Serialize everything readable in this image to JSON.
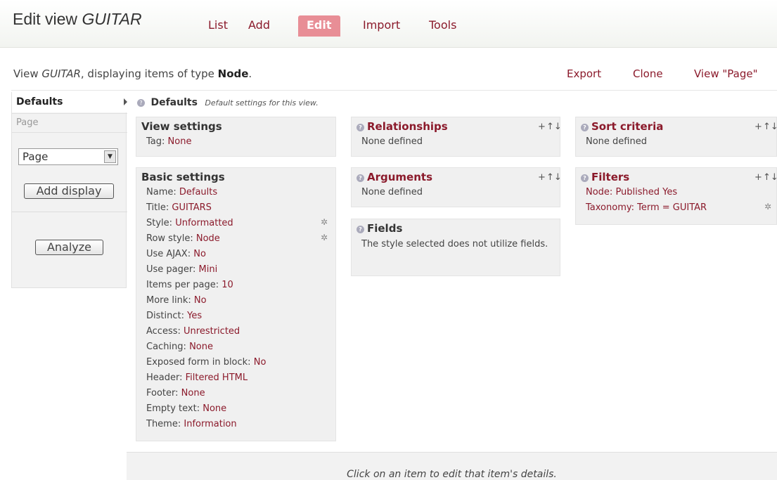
{
  "header": {
    "title_prefix": "Edit view",
    "title_name": "GUITAR",
    "tabs": [
      {
        "label": "List"
      },
      {
        "label": "Add"
      },
      {
        "label": "Edit"
      },
      {
        "label": "Import"
      },
      {
        "label": "Tools"
      }
    ]
  },
  "info": {
    "prefix": "View",
    "view_name": "GUITAR",
    "middle": ", displaying items of type",
    "type": "Node",
    "suffix": ".",
    "links": [
      "Export",
      "Clone",
      "View \"Page\""
    ]
  },
  "sidebar": {
    "tab_defaults": "Defaults",
    "tab_page": "Page",
    "select_value": "Page",
    "add_display_label": "Add display",
    "analyze_label": "Analyze"
  },
  "main": {
    "heading": "Defaults",
    "heading_note": "Default settings for this view.",
    "view_settings": {
      "title": "View settings",
      "tag_label": "Tag:",
      "tag_value": "None"
    },
    "basic_settings": {
      "title": "Basic settings",
      "rows": [
        {
          "label": "Name:",
          "value": "Defaults"
        },
        {
          "label": "Title:",
          "value": "GUITARS"
        },
        {
          "label": "Style:",
          "value": "Unformatted"
        },
        {
          "label": "Row style:",
          "value": "Node"
        },
        {
          "label": "Use AJAX:",
          "value": "No"
        },
        {
          "label": "Use pager:",
          "value": "Mini"
        },
        {
          "label": "Items per page:",
          "value": "10"
        },
        {
          "label": "More link:",
          "value": "No"
        },
        {
          "label": "Distinct:",
          "value": "Yes"
        },
        {
          "label": "Access:",
          "value": "Unrestricted"
        },
        {
          "label": "Caching:",
          "value": "None"
        },
        {
          "label": "Exposed form in block:",
          "value": "No"
        },
        {
          "label": "Header:",
          "value": "Filtered HTML"
        },
        {
          "label": "Footer:",
          "value": "None"
        },
        {
          "label": "Empty text:",
          "value": "None"
        },
        {
          "label": "Theme:",
          "value": "Information"
        }
      ]
    },
    "relationships": {
      "title": "Relationships",
      "text": "None defined"
    },
    "arguments": {
      "title": "Arguments",
      "text": "None defined"
    },
    "fields": {
      "title": "Fields",
      "text": "The style selected does not utilize fields."
    },
    "sort_criteria": {
      "title": "Sort criteria",
      "text": "None defined"
    },
    "filters": {
      "title": "Filters",
      "row1": "Node: Published Yes",
      "row2": "Taxonomy: Term = GUITAR"
    },
    "add_symbol": "+",
    "rearrange_symbol": "↑↓"
  },
  "footer": {
    "text": "Click on an item to edit that item's details."
  }
}
